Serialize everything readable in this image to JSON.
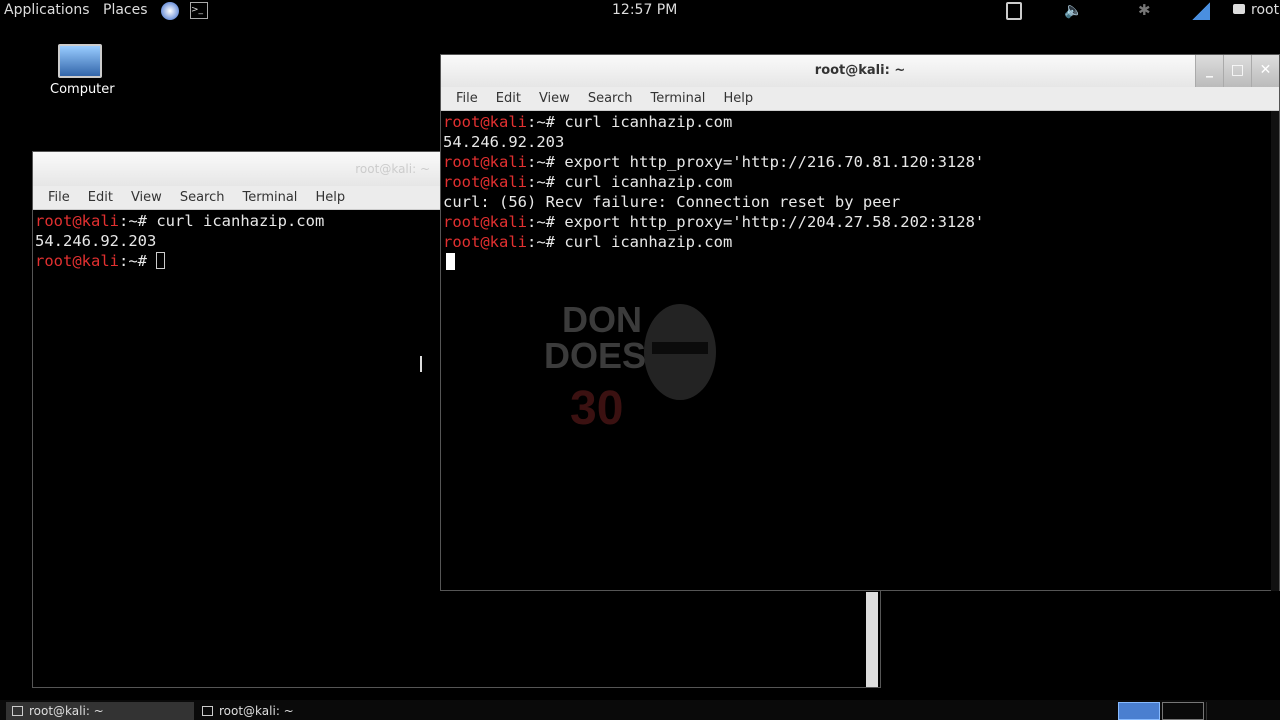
{
  "topbar": {
    "applications": "Applications",
    "places": "Places",
    "clock": "12:57 PM",
    "user": "root",
    "icons": [
      "browser-icon",
      "terminal-icon",
      "battery-icon",
      "volume-muted-icon",
      "bluetooth-off-icon",
      "network-signal-icon",
      "chat-icon"
    ]
  },
  "desktop": {
    "computer_label": "Computer"
  },
  "menu": [
    "File",
    "Edit",
    "View",
    "Search",
    "Terminal",
    "Help"
  ],
  "left_window": {
    "title": "root@kali: ~",
    "lines": [
      {
        "prompt": "root@kali",
        "rest": ":~# curl icanhazip.com"
      },
      {
        "text": "54.246.92.203"
      },
      {
        "prompt": "root@kali",
        "rest": ":~# "
      }
    ]
  },
  "right_window": {
    "title": "root@kali: ~",
    "lines": [
      {
        "prompt": "root@kali",
        "rest": ":~# curl icanhazip.com"
      },
      {
        "text": "54.246.92.203"
      },
      {
        "prompt": "root@kali",
        "rest": ":~# export http_proxy='http://216.70.81.120:3128'"
      },
      {
        "prompt": "root@kali",
        "rest": ":~# curl icanhazip.com"
      },
      {
        "text": "curl: (56) Recv failure: Connection reset by peer"
      },
      {
        "prompt": "root@kali",
        "rest": ":~# export http_proxy='http://204.27.58.202:3128'"
      },
      {
        "prompt": "root@kali",
        "rest": ":~# curl icanhazip.com"
      }
    ]
  },
  "watermark": {
    "logo_text": "DON DOES 30"
  },
  "taskbar": {
    "tasks": [
      "root@kali: ~",
      "root@kali: ~"
    ]
  },
  "colors": {
    "prompt": "#e23030",
    "titlebar": "#f0f0f0"
  }
}
